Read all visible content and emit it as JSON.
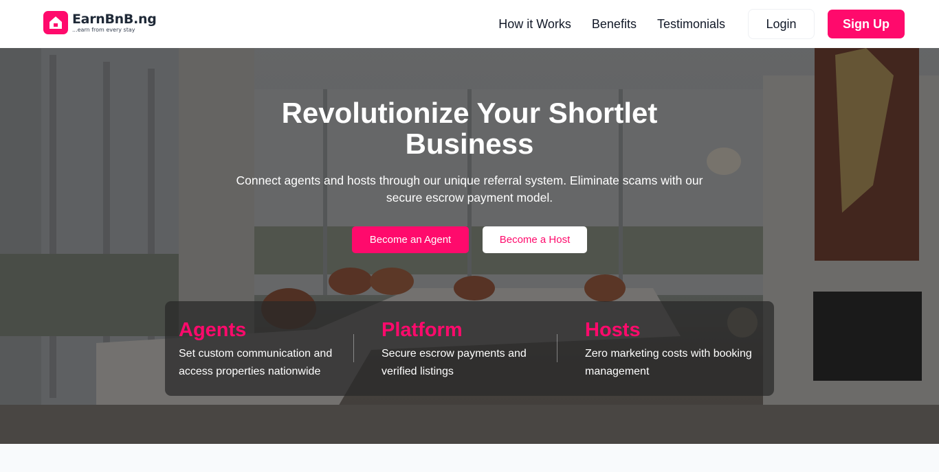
{
  "brand": {
    "name": "EarnBnB.ng",
    "tagline": "...earn from every stay",
    "accent_color": "#ff0a6c",
    "logo_icon": "house-icon"
  },
  "nav": {
    "links": [
      "How it Works",
      "Benefits",
      "Testimonials"
    ],
    "login_label": "Login",
    "signup_label": "Sign Up"
  },
  "hero": {
    "title": "Revolutionize Your Shortlet Business",
    "subtitle": "Connect agents and hosts through our unique referral system. Eliminate scams with our secure escrow payment model.",
    "primary_cta": "Become an Agent",
    "secondary_cta": "Become a Host",
    "features": [
      {
        "title": "Agents",
        "description": "Set custom communication and access properties nationwide"
      },
      {
        "title": "Platform",
        "description": "Secure escrow payments and verified listings"
      },
      {
        "title": "Hosts",
        "description": "Zero marketing costs with booking management"
      }
    ]
  }
}
